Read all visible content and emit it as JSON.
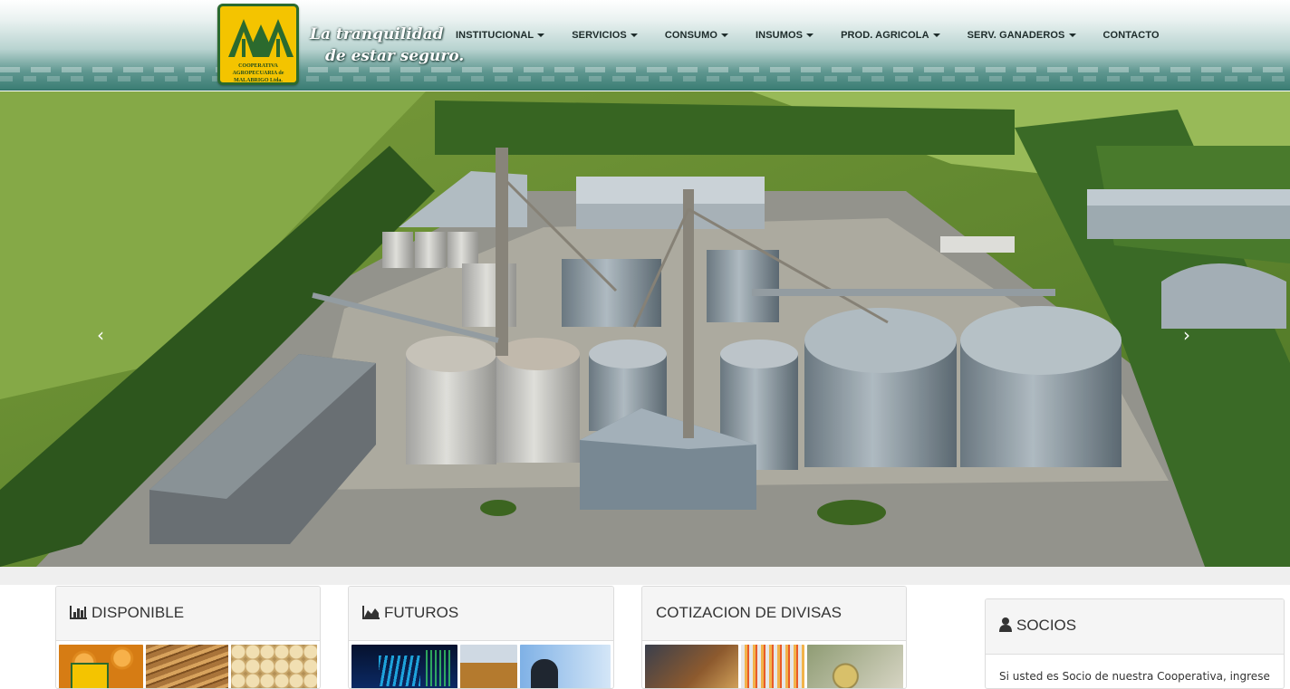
{
  "header": {
    "logo_text": "COOPERATIVA AGROPECUARIA de MALABRIGO Ltda.",
    "slogan_line1": "La tranquilidad",
    "slogan_line2": "de estar seguro.",
    "nav": [
      {
        "label": "INSTITUCIONAL",
        "dropdown": true
      },
      {
        "label": "SERVICIOS",
        "dropdown": true
      },
      {
        "label": "CONSUMO",
        "dropdown": true
      },
      {
        "label": "INSUMOS",
        "dropdown": true
      },
      {
        "label": "PROD. AGRICOLA",
        "dropdown": true
      },
      {
        "label": "SERV. GANADEROS",
        "dropdown": true
      },
      {
        "label": "CONTACTO",
        "dropdown": false
      }
    ]
  },
  "hero": {
    "prev_icon": "‹",
    "next_icon": "›"
  },
  "panels": {
    "disponible": {
      "title": "DISPONIBLE",
      "icon": "bar-chart-icon"
    },
    "futuros": {
      "title": "FUTUROS",
      "icon": "area-chart-icon"
    },
    "divisas": {
      "title": "COTIZACION DE DIVISAS"
    },
    "socios": {
      "title": "SOCIOS",
      "icon": "user-icon",
      "text": "Si usted es Socio de nuestra Cooperativa, ingrese"
    }
  },
  "colors": {
    "header_teal": "#3b7d74",
    "logo_yellow": "#f4c400",
    "logo_green": "#2b6a2e"
  }
}
